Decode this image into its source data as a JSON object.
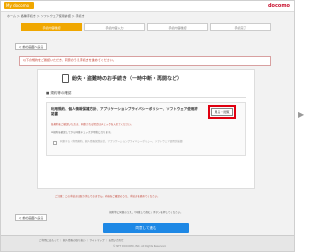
{
  "header": {
    "logo_text": "My docomo",
    "brand": "docomo"
  },
  "breadcrumb": "ホーム ＞ 各種手続き ＞ ソフトウェア使用許諾 ＞ 手続き",
  "steps": [
    {
      "label": "手続内容確認",
      "active": true
    },
    {
      "label": "手続内容入力",
      "active": false
    },
    {
      "label": "手続内容確認",
      "active": false
    },
    {
      "label": "手続完了",
      "active": false
    }
  ],
  "back_label": "＜ 前の画面へ戻る",
  "notice": "以下の規約をご確認いただき、同意のうえ手続きを進めてください。",
  "card": {
    "title": "紛失・盗難時のお手続き（一時中断・再開など）",
    "section_label": "■ 規約等の確認",
    "agree_title": "利用規約、個人情報保護方針、アプリケーションプライバシーポリシー、ソフトウェア使用許諾書",
    "view_button": "見る・閲覧",
    "desc": "各規約をご確認いただき、同意される場合はチェックを入れてください。",
    "note": "※規約を確認してから同意チェックが可能になります。",
    "checkbox_label": "同意する（利用規約、個人情報保護方針、アプリケーションプライバシーポリシー、ソフトウェア使用許諾書）"
  },
  "warning": "ご注意：この手続きは取り消しできません。内容をご確認のうえ、手続きを進めてください。",
  "agree_line": "規約等に同意のうえ、「同意して進む」ボタンを押してください。",
  "confirm_button": "同意して進む",
  "footer": {
    "links": "ご利用にあたって ｜ 個人情報の取り扱い ｜ サイトマップ ｜ お問い合わせ",
    "copyright": "© NTT DOCOMO, INC. All Rights Reserved."
  }
}
